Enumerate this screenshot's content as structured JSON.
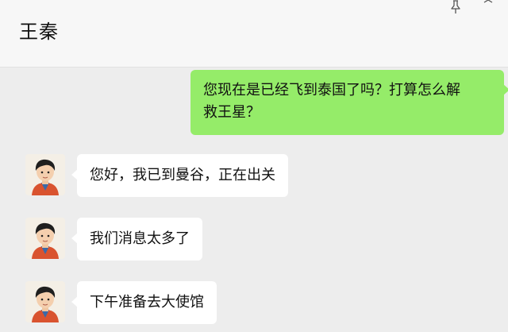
{
  "header": {
    "title": "王秦",
    "pin_icon": "pin-icon",
    "more_icon": "more-icon"
  },
  "messages": [
    {
      "direction": "outgoing",
      "lines": [
        "您现在是已经飞到泰国了吗？打算怎么解",
        "救王星？"
      ]
    },
    {
      "direction": "incoming",
      "text": "您好，我已到曼谷，正在出关"
    },
    {
      "direction": "incoming",
      "text": "我们消息太多了"
    },
    {
      "direction": "incoming",
      "text": "下午准备去大使馆"
    }
  ],
  "colors": {
    "outgoing_bubble": "#95ec69",
    "incoming_bubble": "#ffffff",
    "background": "#ededed"
  }
}
